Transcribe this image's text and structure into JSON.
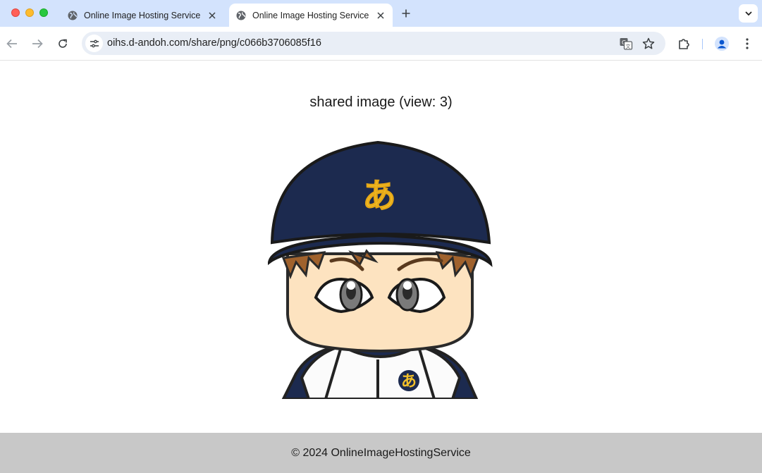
{
  "browser": {
    "tabs": [
      {
        "title": "Online Image Hosting Service",
        "active": false
      },
      {
        "title": "Online Image Hosting Service",
        "active": true
      }
    ],
    "address_bar": {
      "url": "oihs.d-andoh.com/share/png/c066b3706085f16"
    },
    "icons": {
      "back": "arrow-left-icon",
      "forward": "arrow-right-icon",
      "reload": "reload-icon",
      "site_info": "tune-icon",
      "translate": "translate-icon",
      "bookmark": "star-icon",
      "extensions": "puzzle-icon",
      "profile": "person-icon",
      "menu": "kebab-menu-icon"
    }
  },
  "page": {
    "title": "shared image (view: 3)",
    "image": {
      "cap_letter": "あ",
      "jersey_letter": "あ"
    },
    "footer": "© 2024 OnlineImageHostingService"
  },
  "colors": {
    "tab_strip": "#d3e3fd",
    "omnibox": "#e9eef6",
    "footer": "#c8c8c8",
    "cap_navy": "#1c2a4f",
    "letter_yellow": "#f2c02a",
    "skin": "#fde3c0",
    "hair": "#a0622d"
  }
}
